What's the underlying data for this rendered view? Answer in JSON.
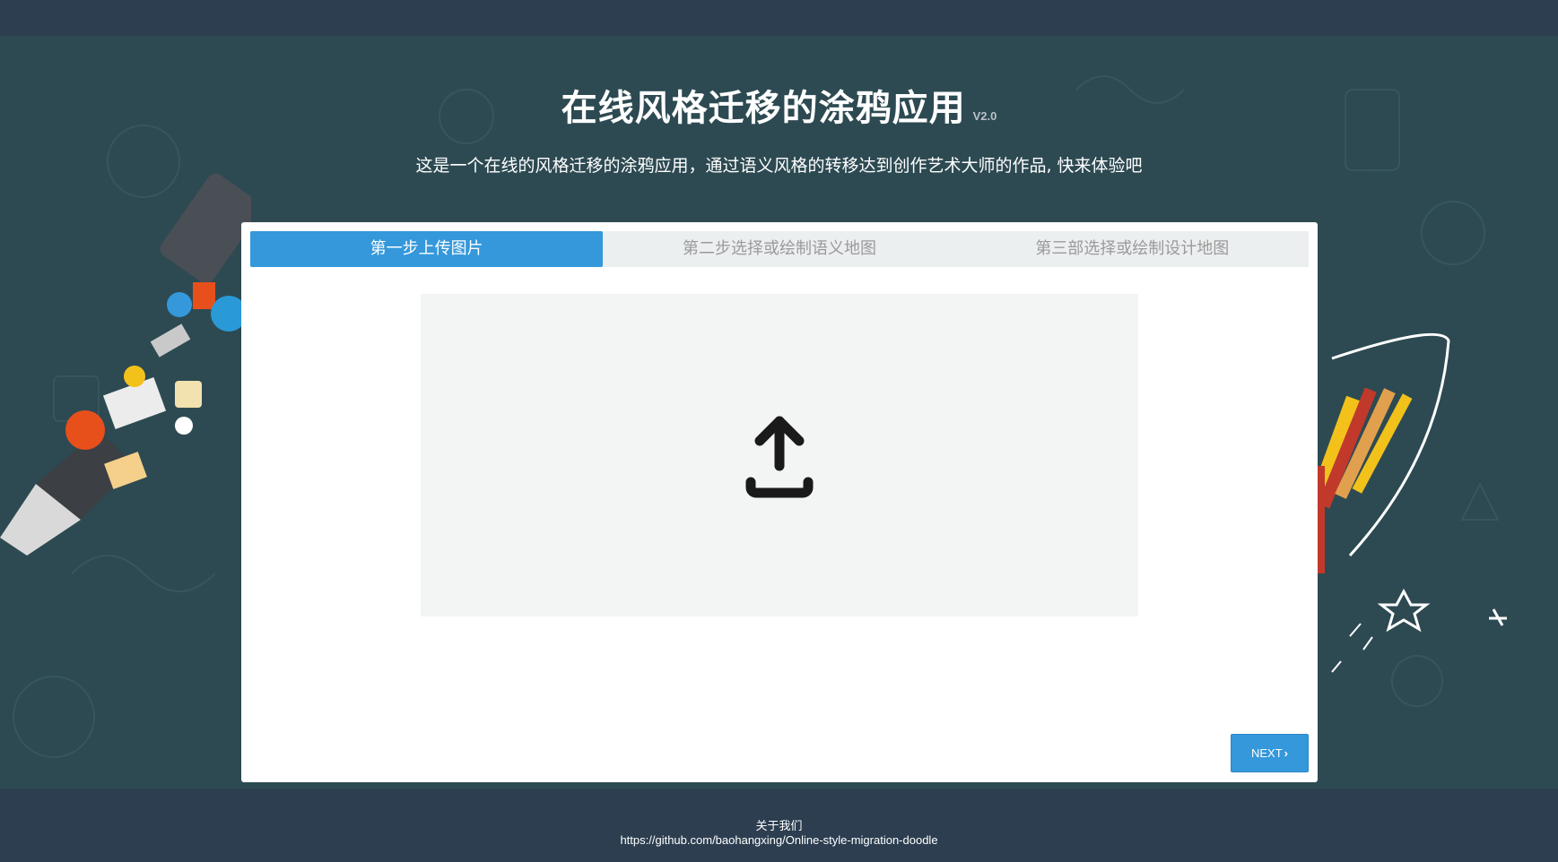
{
  "header": {
    "title": "在线风格迁移的涂鸦应用",
    "version": "V2.0",
    "subtitle": "这是一个在线的风格迁移的涂鸦应用，通过语义风格的转移达到创作艺术大师的作品, 快来体验吧"
  },
  "wizard": {
    "tabs": [
      {
        "label": "第一步上传图片",
        "active": true
      },
      {
        "label": "第二步选择或绘制语义地图",
        "active": false
      },
      {
        "label": "第三部选择或绘制设计地图",
        "active": false
      }
    ],
    "upload": {
      "icon": "upload-icon"
    },
    "next_label": "NEXT",
    "next_icon": "chevron-right-icon"
  },
  "footer": {
    "about": "关于我们",
    "link": "https://github.com/baohangxing/Online-style-migration-doodle"
  },
  "colors": {
    "topbar": "#2c3e50",
    "hero": "#2d4a52",
    "accent": "#3498db",
    "tab_inactive_bg": "#eceff0",
    "upload_bg": "#f3f4f4"
  }
}
